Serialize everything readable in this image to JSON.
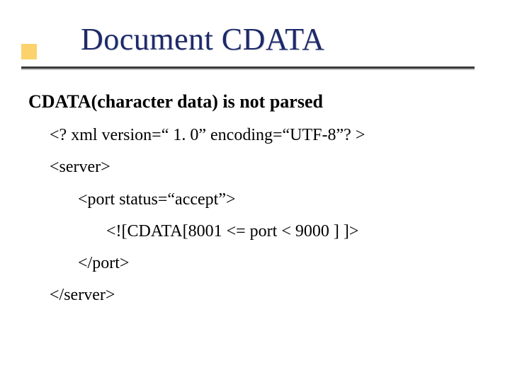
{
  "title": "Document CDATA",
  "subtitle": "CDATA(character data) is not parsed",
  "code": {
    "l1": "<? xml version=“ 1. 0” encoding=“UTF-8”? >",
    "l2": "<server>",
    "l3": "<port status=“accept”>",
    "l4": "<![CDATA[8001 <= port < 9000 ] ]>",
    "l5": "</port>",
    "l6": "</server>"
  }
}
